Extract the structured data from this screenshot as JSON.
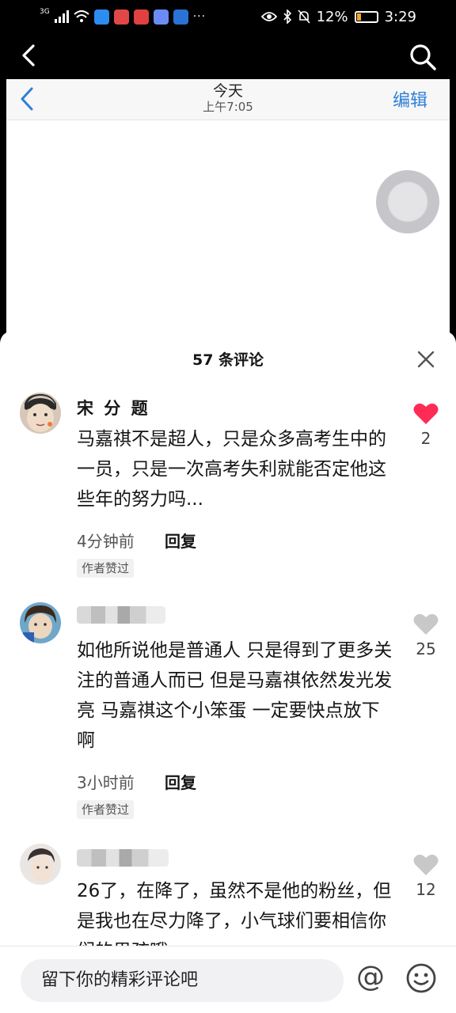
{
  "status_bar": {
    "network": "3G",
    "more": "···",
    "battery": "12%",
    "time": "3:29"
  },
  "video_header": {
    "inner_title": "今天",
    "inner_time": "上午7:05",
    "edit_label": "编辑"
  },
  "sheet": {
    "title": "57 条评论"
  },
  "comments": [
    {
      "name": "宋 分 题",
      "text": "马嘉祺不是超人，只是众多高考生中的一员，只是一次高考失利就能否定他这些年的努力吗...",
      "time": "4分钟前",
      "reply": "回复",
      "badge": "作者赞过",
      "likes": "2",
      "liked": true
    },
    {
      "name": "",
      "text": "如他所说他是普通人 只是得到了更多关注的普通人而已 但是马嘉祺依然发光发亮 马嘉祺这个小笨蛋 一定要快点放下啊",
      "time": "3小时前",
      "reply": "回复",
      "badge": "作者赞过",
      "likes": "25",
      "liked": false
    },
    {
      "name": "",
      "text": "26了，在降了，虽然不是他的粉丝，但是我也在尽力降了，小气球们要相信你们的男孩哦",
      "likes": "12",
      "liked": false
    }
  ],
  "input": {
    "placeholder": "留下你的精彩评论吧",
    "at_symbol": "@"
  },
  "colors": {
    "like_active": "#fe2c55",
    "like_inactive": "#c8c8c8",
    "edit_blue": "#2f7fd6"
  },
  "icons": [
    "back-arrow-icon",
    "search-icon",
    "close-icon",
    "heart-icon",
    "emoji-icon",
    "at-icon"
  ]
}
